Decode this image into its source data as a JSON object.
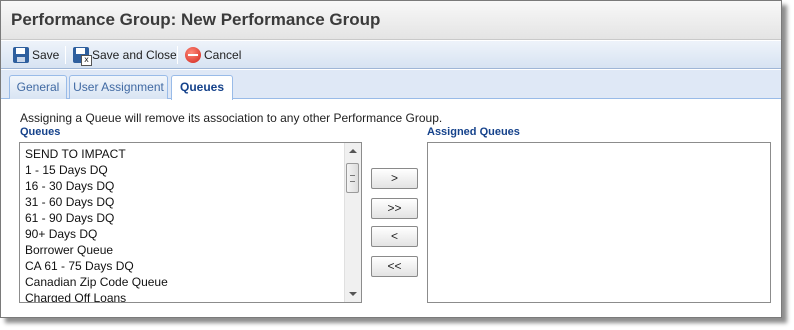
{
  "window": {
    "title": "Performance Group: New Performance Group"
  },
  "toolbar": {
    "save_label": "Save",
    "save_close_label": "Save and Close",
    "cancel_label": "Cancel"
  },
  "tabs": [
    {
      "label": "General",
      "active": false
    },
    {
      "label": "User Assignment",
      "active": false
    },
    {
      "label": "Queues",
      "active": true
    }
  ],
  "queues_panel": {
    "notice": "Assigning a Queue will remove its association to any other Performance Group.",
    "available_label": "Queues",
    "assigned_label": "Assigned Queues",
    "available_items": [
      "SEND TO IMPACT",
      "1 - 15 Days DQ",
      "16 - 30 Days DQ",
      "31 - 60 Days DQ",
      "61 - 90 Days DQ",
      "90+ Days DQ",
      "Borrower Queue",
      "CA 61 - 75 Days DQ",
      "Canadian Zip Code Queue",
      "Charged Off Loans"
    ],
    "assigned_items": [],
    "buttons": {
      "add": ">",
      "add_all": ">>",
      "remove": "<",
      "remove_all": "<<"
    }
  },
  "icons": {
    "save": "save-icon",
    "save_close": "save-close-icon",
    "cancel": "cancel-icon"
  },
  "colors": {
    "header_text": "#15428b",
    "tab_bar": "#dfe8f6",
    "toolbar": "#d7e3f2"
  }
}
